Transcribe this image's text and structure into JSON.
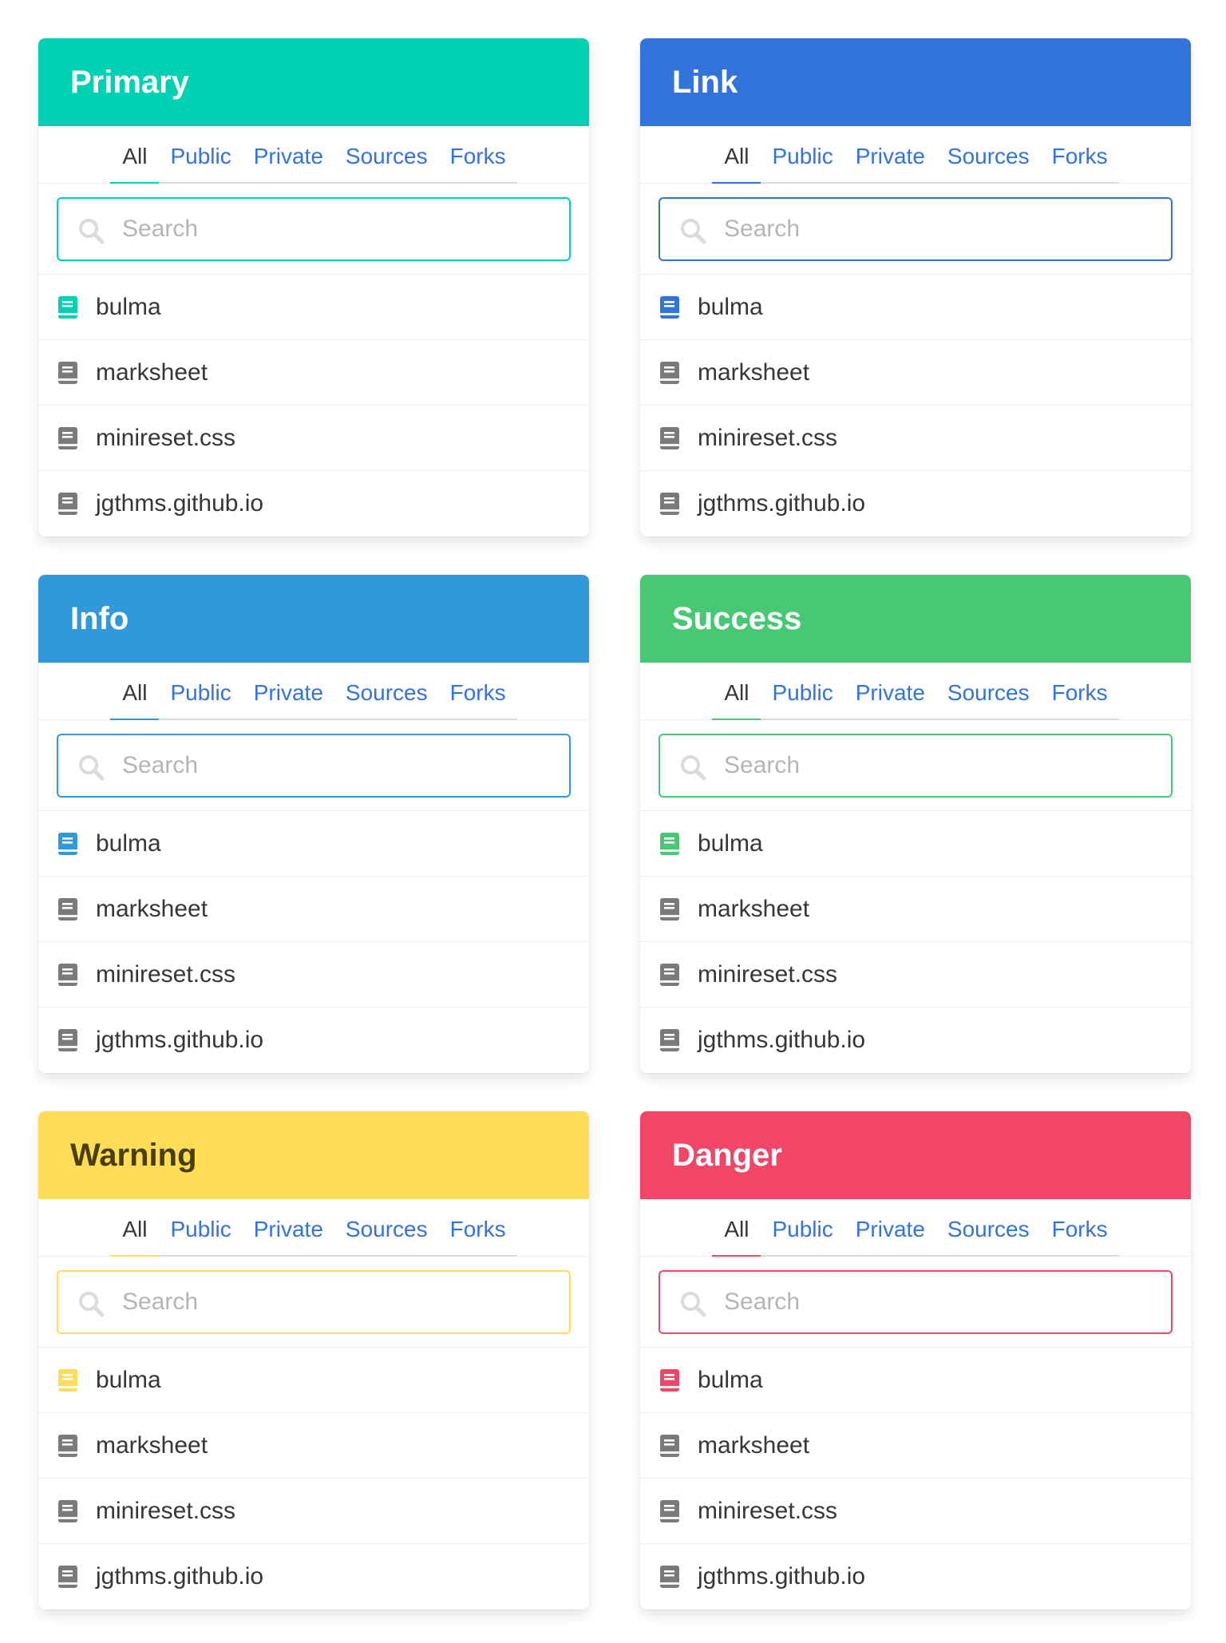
{
  "tabs": [
    "All",
    "Public",
    "Private",
    "Sources",
    "Forks"
  ],
  "search_placeholder": "Search",
  "items": [
    "bulma",
    "marksheet",
    "minireset.css",
    "jgthms.github.io"
  ],
  "icons": {
    "search": "search-icon",
    "repo": "book-icon"
  },
  "colors": {
    "link": "#3273dc",
    "inactive_icon": "#7a7a7a"
  },
  "panels": [
    {
      "title": "Primary",
      "color": "#00d1b2",
      "text_color": "#ffffff"
    },
    {
      "title": "Link",
      "color": "#3273dc",
      "text_color": "#ffffff"
    },
    {
      "title": "Info",
      "color": "#3298dc",
      "text_color": "#ffffff"
    },
    {
      "title": "Success",
      "color": "#48c774",
      "text_color": "#ffffff"
    },
    {
      "title": "Warning",
      "color": "#ffdd57",
      "text_color": "#4a3e0a"
    },
    {
      "title": "Danger",
      "color": "#f14668",
      "text_color": "#ffffff"
    }
  ]
}
